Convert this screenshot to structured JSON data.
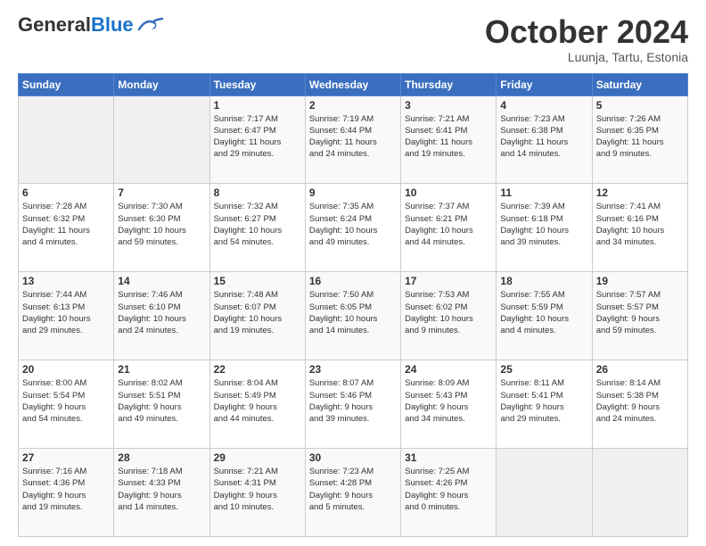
{
  "header": {
    "logo_general": "General",
    "logo_blue": "Blue",
    "month_title": "October 2024",
    "subtitle": "Luunja, Tartu, Estonia"
  },
  "days_of_week": [
    "Sunday",
    "Monday",
    "Tuesday",
    "Wednesday",
    "Thursday",
    "Friday",
    "Saturday"
  ],
  "weeks": [
    [
      {
        "num": "",
        "info": ""
      },
      {
        "num": "",
        "info": ""
      },
      {
        "num": "1",
        "info": "Sunrise: 7:17 AM\nSunset: 6:47 PM\nDaylight: 11 hours\nand 29 minutes."
      },
      {
        "num": "2",
        "info": "Sunrise: 7:19 AM\nSunset: 6:44 PM\nDaylight: 11 hours\nand 24 minutes."
      },
      {
        "num": "3",
        "info": "Sunrise: 7:21 AM\nSunset: 6:41 PM\nDaylight: 11 hours\nand 19 minutes."
      },
      {
        "num": "4",
        "info": "Sunrise: 7:23 AM\nSunset: 6:38 PM\nDaylight: 11 hours\nand 14 minutes."
      },
      {
        "num": "5",
        "info": "Sunrise: 7:26 AM\nSunset: 6:35 PM\nDaylight: 11 hours\nand 9 minutes."
      }
    ],
    [
      {
        "num": "6",
        "info": "Sunrise: 7:28 AM\nSunset: 6:32 PM\nDaylight: 11 hours\nand 4 minutes."
      },
      {
        "num": "7",
        "info": "Sunrise: 7:30 AM\nSunset: 6:30 PM\nDaylight: 10 hours\nand 59 minutes."
      },
      {
        "num": "8",
        "info": "Sunrise: 7:32 AM\nSunset: 6:27 PM\nDaylight: 10 hours\nand 54 minutes."
      },
      {
        "num": "9",
        "info": "Sunrise: 7:35 AM\nSunset: 6:24 PM\nDaylight: 10 hours\nand 49 minutes."
      },
      {
        "num": "10",
        "info": "Sunrise: 7:37 AM\nSunset: 6:21 PM\nDaylight: 10 hours\nand 44 minutes."
      },
      {
        "num": "11",
        "info": "Sunrise: 7:39 AM\nSunset: 6:18 PM\nDaylight: 10 hours\nand 39 minutes."
      },
      {
        "num": "12",
        "info": "Sunrise: 7:41 AM\nSunset: 6:16 PM\nDaylight: 10 hours\nand 34 minutes."
      }
    ],
    [
      {
        "num": "13",
        "info": "Sunrise: 7:44 AM\nSunset: 6:13 PM\nDaylight: 10 hours\nand 29 minutes."
      },
      {
        "num": "14",
        "info": "Sunrise: 7:46 AM\nSunset: 6:10 PM\nDaylight: 10 hours\nand 24 minutes."
      },
      {
        "num": "15",
        "info": "Sunrise: 7:48 AM\nSunset: 6:07 PM\nDaylight: 10 hours\nand 19 minutes."
      },
      {
        "num": "16",
        "info": "Sunrise: 7:50 AM\nSunset: 6:05 PM\nDaylight: 10 hours\nand 14 minutes."
      },
      {
        "num": "17",
        "info": "Sunrise: 7:53 AM\nSunset: 6:02 PM\nDaylight: 10 hours\nand 9 minutes."
      },
      {
        "num": "18",
        "info": "Sunrise: 7:55 AM\nSunset: 5:59 PM\nDaylight: 10 hours\nand 4 minutes."
      },
      {
        "num": "19",
        "info": "Sunrise: 7:57 AM\nSunset: 5:57 PM\nDaylight: 9 hours\nand 59 minutes."
      }
    ],
    [
      {
        "num": "20",
        "info": "Sunrise: 8:00 AM\nSunset: 5:54 PM\nDaylight: 9 hours\nand 54 minutes."
      },
      {
        "num": "21",
        "info": "Sunrise: 8:02 AM\nSunset: 5:51 PM\nDaylight: 9 hours\nand 49 minutes."
      },
      {
        "num": "22",
        "info": "Sunrise: 8:04 AM\nSunset: 5:49 PM\nDaylight: 9 hours\nand 44 minutes."
      },
      {
        "num": "23",
        "info": "Sunrise: 8:07 AM\nSunset: 5:46 PM\nDaylight: 9 hours\nand 39 minutes."
      },
      {
        "num": "24",
        "info": "Sunrise: 8:09 AM\nSunset: 5:43 PM\nDaylight: 9 hours\nand 34 minutes."
      },
      {
        "num": "25",
        "info": "Sunrise: 8:11 AM\nSunset: 5:41 PM\nDaylight: 9 hours\nand 29 minutes."
      },
      {
        "num": "26",
        "info": "Sunrise: 8:14 AM\nSunset: 5:38 PM\nDaylight: 9 hours\nand 24 minutes."
      }
    ],
    [
      {
        "num": "27",
        "info": "Sunrise: 7:16 AM\nSunset: 4:36 PM\nDaylight: 9 hours\nand 19 minutes."
      },
      {
        "num": "28",
        "info": "Sunrise: 7:18 AM\nSunset: 4:33 PM\nDaylight: 9 hours\nand 14 minutes."
      },
      {
        "num": "29",
        "info": "Sunrise: 7:21 AM\nSunset: 4:31 PM\nDaylight: 9 hours\nand 10 minutes."
      },
      {
        "num": "30",
        "info": "Sunrise: 7:23 AM\nSunset: 4:28 PM\nDaylight: 9 hours\nand 5 minutes."
      },
      {
        "num": "31",
        "info": "Sunrise: 7:25 AM\nSunset: 4:26 PM\nDaylight: 9 hours\nand 0 minutes."
      },
      {
        "num": "",
        "info": ""
      },
      {
        "num": "",
        "info": ""
      }
    ]
  ]
}
